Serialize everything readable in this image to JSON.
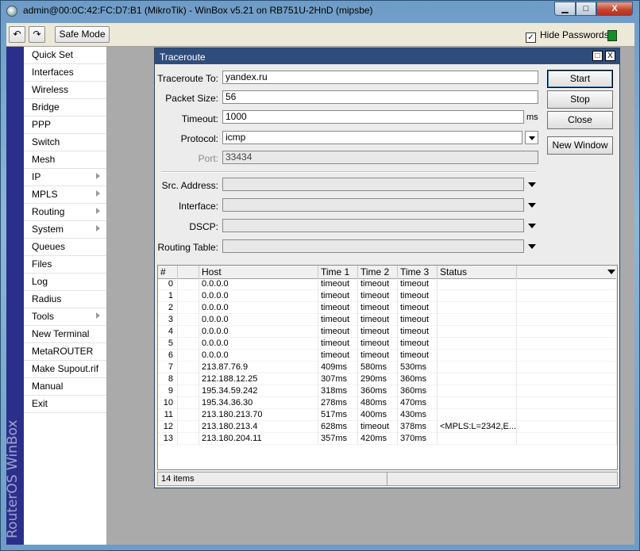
{
  "window": {
    "title": "admin@00:0C:42:FC:D7:B1 (MikroTik) - WinBox v5.21 on RB751U-2HnD (mipsbe)",
    "minimize_glyph": "▁",
    "maximize_glyph": "□",
    "close_glyph": "X"
  },
  "toolbar": {
    "undo_icon": "↶",
    "redo_icon": "↷",
    "safe_mode_label": "Safe Mode",
    "hide_passwords_label": "Hide Passwords",
    "hide_passwords_checked": "✓",
    "status_color": "#1a8a2a",
    "lock_icon": "🔒"
  },
  "brand": {
    "text": "RouterOS WinBox"
  },
  "menu": {
    "items": [
      {
        "label": "Quick Set"
      },
      {
        "label": "Interfaces"
      },
      {
        "label": "Wireless"
      },
      {
        "label": "Bridge"
      },
      {
        "label": "PPP"
      },
      {
        "label": "Switch"
      },
      {
        "label": "Mesh"
      },
      {
        "label": "IP",
        "submenu": true
      },
      {
        "label": "MPLS",
        "submenu": true
      },
      {
        "label": "Routing",
        "submenu": true
      },
      {
        "label": "System",
        "submenu": true
      },
      {
        "label": "Queues"
      },
      {
        "label": "Files"
      },
      {
        "label": "Log"
      },
      {
        "label": "Radius"
      },
      {
        "label": "Tools",
        "submenu": true
      },
      {
        "label": "New Terminal"
      },
      {
        "label": "MetaROUTER"
      },
      {
        "label": "Make Supout.rif"
      },
      {
        "label": "Manual"
      },
      {
        "label": "Exit"
      }
    ]
  },
  "traceroute": {
    "title": "Traceroute",
    "restore_glyph": "□",
    "close_glyph": "X",
    "fields": {
      "traceroute_to": {
        "label": "Traceroute To:",
        "value": "yandex.ru"
      },
      "packet_size": {
        "label": "Packet Size:",
        "value": "56"
      },
      "timeout": {
        "label": "Timeout:",
        "value": "1000",
        "unit": "ms"
      },
      "protocol": {
        "label": "Protocol:",
        "value": "icmp"
      },
      "port": {
        "label": "Port:",
        "value": "33434"
      },
      "src_address": {
        "label": "Src. Address:",
        "value": ""
      },
      "interface": {
        "label": "Interface:",
        "value": ""
      },
      "dscp": {
        "label": "DSCP:",
        "value": ""
      },
      "routing_table": {
        "label": "Routing Table:",
        "value": ""
      }
    },
    "buttons": {
      "start": "Start",
      "stop": "Stop",
      "close": "Close",
      "new_window": "New Window"
    },
    "columns": [
      "#",
      "",
      "Host",
      "Time 1",
      "Time 2",
      "Time 3",
      "Status"
    ],
    "rows": [
      {
        "num": "0",
        "host": "0.0.0.0",
        "t1": "timeout",
        "t2": "timeout",
        "t3": "timeout",
        "status": ""
      },
      {
        "num": "1",
        "host": "0.0.0.0",
        "t1": "timeout",
        "t2": "timeout",
        "t3": "timeout",
        "status": ""
      },
      {
        "num": "2",
        "host": "0.0.0.0",
        "t1": "timeout",
        "t2": "timeout",
        "t3": "timeout",
        "status": ""
      },
      {
        "num": "3",
        "host": "0.0.0.0",
        "t1": "timeout",
        "t2": "timeout",
        "t3": "timeout",
        "status": ""
      },
      {
        "num": "4",
        "host": "0.0.0.0",
        "t1": "timeout",
        "t2": "timeout",
        "t3": "timeout",
        "status": ""
      },
      {
        "num": "5",
        "host": "0.0.0.0",
        "t1": "timeout",
        "t2": "timeout",
        "t3": "timeout",
        "status": ""
      },
      {
        "num": "6",
        "host": "0.0.0.0",
        "t1": "timeout",
        "t2": "timeout",
        "t3": "timeout",
        "status": ""
      },
      {
        "num": "7",
        "host": "213.87.76.9",
        "t1": "409ms",
        "t2": "580ms",
        "t3": "530ms",
        "status": ""
      },
      {
        "num": "8",
        "host": "212.188.12.25",
        "t1": "307ms",
        "t2": "290ms",
        "t3": "360ms",
        "status": ""
      },
      {
        "num": "9",
        "host": "195.34.59.242",
        "t1": "318ms",
        "t2": "360ms",
        "t3": "360ms",
        "status": ""
      },
      {
        "num": "10",
        "host": "195.34.36.30",
        "t1": "278ms",
        "t2": "480ms",
        "t3": "470ms",
        "status": ""
      },
      {
        "num": "11",
        "host": "213.180.213.70",
        "t1": "517ms",
        "t2": "400ms",
        "t3": "430ms",
        "status": ""
      },
      {
        "num": "12",
        "host": "213.180.213.4",
        "t1": "628ms",
        "t2": "timeout",
        "t3": "378ms",
        "status": "<MPLS:L=2342,E..."
      },
      {
        "num": "13",
        "host": "213.180.204.11",
        "t1": "357ms",
        "t2": "420ms",
        "t3": "370ms",
        "status": ""
      }
    ],
    "item_count": "14 items"
  }
}
